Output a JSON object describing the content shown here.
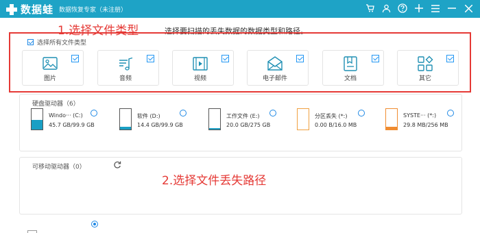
{
  "titlebar": {
    "logo_text": "数据蛙",
    "app_name": "数据恢复专家（未注册）",
    "icons": [
      "cart-icon",
      "user-icon",
      "help-icon",
      "plus-icon",
      "menu-icon",
      "minimize-icon",
      "close-icon"
    ]
  },
  "instruction": "选择要扫描的丢失数据的数据类型和路径。",
  "annotations": {
    "step1": "1.选择文件类型",
    "step2": "2.选择文件丢失路径",
    "color": "#e53935"
  },
  "select_all": {
    "label": "选择所有文件类型",
    "checked": true
  },
  "types": [
    {
      "label": "图片",
      "icon": "image-icon",
      "checked": true
    },
    {
      "label": "音频",
      "icon": "music-icon",
      "checked": true
    },
    {
      "label": "视频",
      "icon": "video-icon",
      "checked": true
    },
    {
      "label": "电子邮件",
      "icon": "email-icon",
      "checked": true
    },
    {
      "label": "文档",
      "icon": "document-icon",
      "checked": true
    },
    {
      "label": "其它",
      "icon": "other-icon",
      "checked": true
    }
  ],
  "disk_panel": {
    "title": "硬盘驱动器（6）",
    "drives": [
      {
        "name": "Windo··· (C:)",
        "size": "45.7 GB/99.9 GB",
        "fill": 0.46,
        "color": "#1a9fc4"
      },
      {
        "name": "软件 (D:)",
        "size": "14.4 GB/99.9 GB",
        "fill": 0.14,
        "color": "#1a9fc4"
      },
      {
        "name": "工作文件 (E:)",
        "size": "20.0 GB/275 GB",
        "fill": 0.07,
        "color": "#1a9fc4"
      },
      {
        "name": "分区丢失 (*:)",
        "size": "0.00  B/16.0 MB",
        "fill": 0.0,
        "color": "#f0a040"
      },
      {
        "name": "SYSTE··· (*:)",
        "size": "29.8 MB/256 MB",
        "fill": 0.12,
        "color": "#f08c30"
      }
    ]
  },
  "removable_panel": {
    "title": "可移动驱动器（0）"
  },
  "accent": "#1ea3c6"
}
